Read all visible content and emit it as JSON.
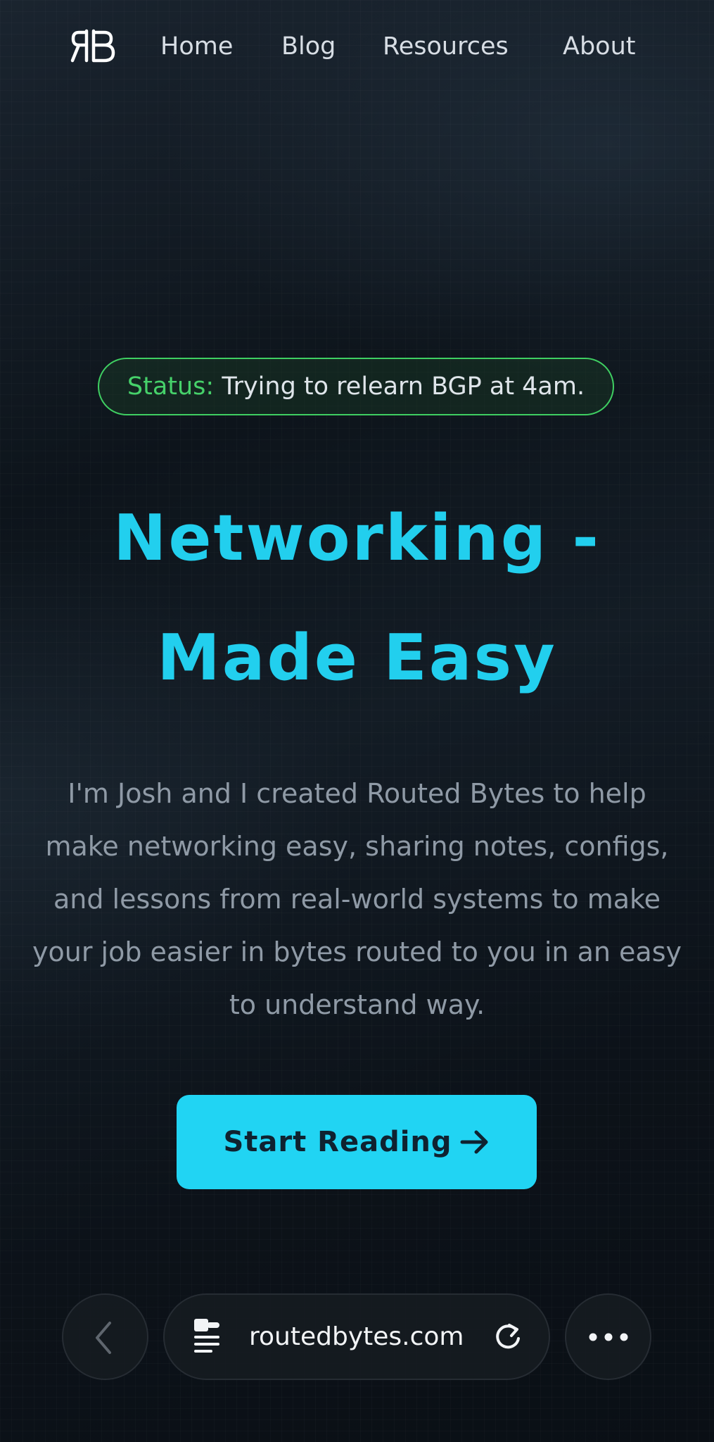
{
  "nav": {
    "logo_text": "RB",
    "links": [
      {
        "label": "Home"
      },
      {
        "label": "Blog"
      },
      {
        "label": "Resources"
      },
      {
        "label": "About"
      }
    ]
  },
  "hero": {
    "status_label": "Status:",
    "status_text": " Trying to relearn BGP at 4am.",
    "title_line1": "Networking -",
    "title_line2": "Made Easy",
    "description": "I'm Josh and I created Routed Bytes to help make networking easy, sharing notes, configs, and lessons from real-world systems to make your job easier in bytes routed to you in an easy to understand way.",
    "cta_label": "Start Reading"
  },
  "browser": {
    "url": "routedbytes.com",
    "icons": {
      "back": "chevron-left-icon",
      "page": "page-settings-icon",
      "reload": "reload-icon",
      "more": "more-icon"
    }
  },
  "colors": {
    "accent": "#22cfee",
    "status_green": "#46d16a",
    "background": "#0b1118"
  }
}
